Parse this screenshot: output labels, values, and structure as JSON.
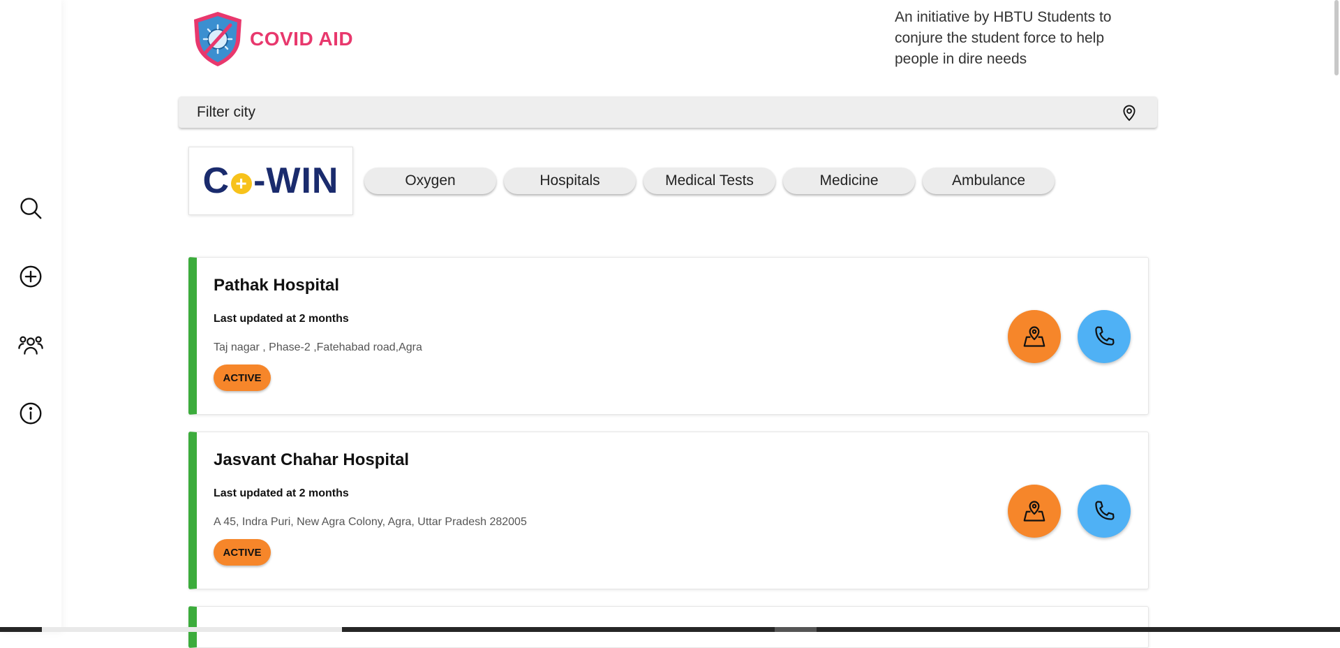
{
  "sidebar": {
    "items": [
      {
        "icon": "search-icon",
        "label": "Search"
      },
      {
        "icon": "plus-circle-icon",
        "label": "Add"
      },
      {
        "icon": "team-icon",
        "label": "Team"
      },
      {
        "icon": "info-icon",
        "label": "About"
      }
    ]
  },
  "header": {
    "brand": "COVID AID",
    "tagline": "An initiative by HBTU Students to conjure the student force to help people in dire needs"
  },
  "filter": {
    "placeholder": "Filter city"
  },
  "cowin": {
    "left": "C",
    "right": "-WIN"
  },
  "categories": [
    "Oxygen",
    "Hospitals",
    "Medical Tests",
    "Medicine",
    "Ambulance"
  ],
  "cards": [
    {
      "name": "Pathak Hospital",
      "updated": "Last updated at 2 months",
      "address": "Taj nagar , Phase-2 ,Fatehabad road,Agra",
      "status": "ACTIVE"
    },
    {
      "name": "Jasvant Chahar Hospital",
      "updated": "Last updated at 2 months",
      "address": "A 45, Indra Puri, New Agra Colony, Agra, Uttar Pradesh 282005",
      "status": "ACTIVE"
    }
  ],
  "colors": {
    "brand": "#e8386d",
    "active_border": "#3cac3c",
    "status_orange": "#f6862a",
    "call_blue": "#4fb1f5"
  }
}
